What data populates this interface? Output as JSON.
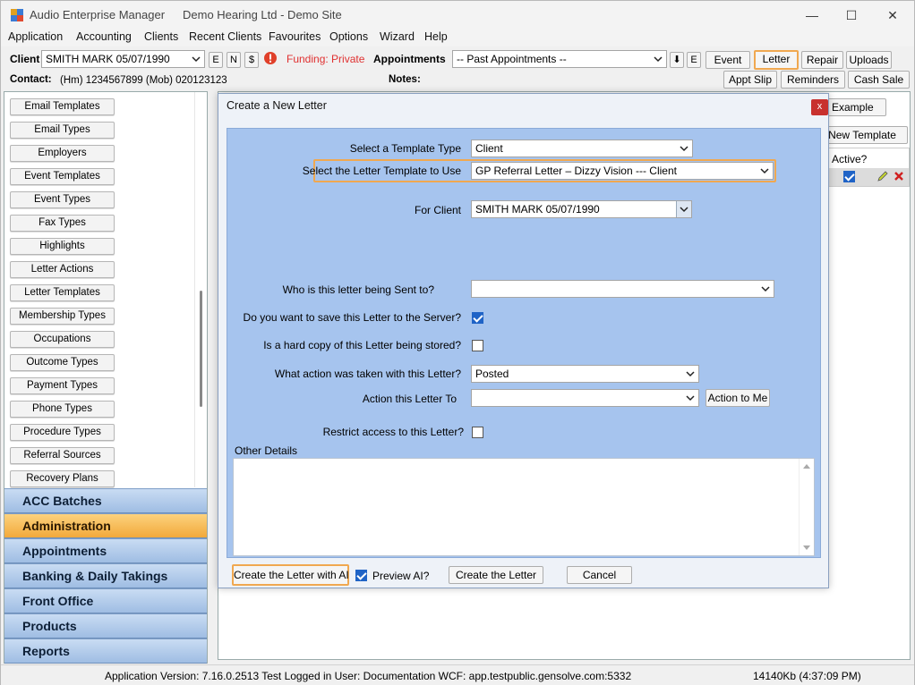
{
  "window": {
    "app_title": "Audio Enterprise Manager",
    "site_title": "Demo Hearing Ltd - Demo Site",
    "min_glyph": "—",
    "max_glyph": "☐",
    "close_glyph": "✕"
  },
  "menu": [
    "Application",
    "Accounting",
    "Clients",
    "Recent Clients",
    "Favourites",
    "Options",
    "Wizard",
    "Help"
  ],
  "toolbar": {
    "client_label": "Client",
    "client_value": "SMITH MARK 05/07/1990",
    "btn_e": "E",
    "btn_n": "N",
    "btn_dollar": "$",
    "funding": "Funding: Private",
    "appointments_label": "Appointments",
    "appointments_value": "-- Past Appointments --",
    "btn_down": "⬇",
    "btn_e2": "E",
    "event": "Event",
    "letter": "Letter",
    "repair": "Repair",
    "uploads": "Uploads",
    "contact_label": "Contact:",
    "contact_value": "(Hm) 1234567899  (Mob) 020123123",
    "notes_label": "Notes:",
    "appt_slip": "Appt Slip",
    "reminders": "Reminders",
    "cash_sale": "Cash Sale"
  },
  "sidebar": {
    "items": [
      "Email Templates",
      "Email Types",
      "Employers",
      "Event Templates",
      "Event Types",
      "Fax Types",
      "Highlights",
      "Letter Actions",
      "Letter Templates",
      "Membership Types",
      "Occupations",
      "Outcome Types",
      "Payment Types",
      "Phone Types",
      "Procedure Types",
      "Referral Sources",
      "Recovery Plans"
    ],
    "nav": [
      "ACC Batches",
      "Administration",
      "Appointments",
      "Banking & Daily Takings",
      "Front Office",
      "Products",
      "Reports"
    ]
  },
  "background_panel": {
    "model_example": "el Example",
    "new_template": "a New Template",
    "active_header": "Active?"
  },
  "dialog": {
    "title": "Create a New Letter",
    "close": "x",
    "template_type_label": "Select a Template Type",
    "template_type_value": "Client",
    "letter_template_label": "Select the Letter Template to Use",
    "letter_template_value": "GP Referral Letter – Dizzy Vision --- Client",
    "for_client_label": "For Client",
    "for_client_value": "SMITH MARK 05/07/1990",
    "sent_to_label": "Who is this letter being Sent to?",
    "sent_to_value": "",
    "save_server_label": "Do you want to save this Letter to the Server?",
    "hard_copy_label": "Is a hard copy of this Letter being stored?",
    "action_taken_label": "What action was taken with this Letter?",
    "action_taken_value": "Posted",
    "action_to_label": "Action this Letter To",
    "action_to_value": "",
    "action_to_me": "Action to Me",
    "restrict_label": "Restrict access to this Letter?",
    "other_details_label": "Other Details",
    "other_details_value": "",
    "create_ai": "Create the Letter with AI",
    "preview_ai": "Preview AI?",
    "create_letter": "Create the Letter",
    "cancel": "Cancel"
  },
  "status": {
    "version": "Application Version: 7.16.0.2513 Test  Logged in User: Documentation WCF: app.testpublic.gensolve.com:5332",
    "memory": "14140Kb  (4:37:09 PM)"
  },
  "colors": {
    "accent_orange": "#f0a850",
    "dialog_blue": "#a6c4ee",
    "funding_red": "#e03030",
    "check_blue": "#1f63c6"
  }
}
